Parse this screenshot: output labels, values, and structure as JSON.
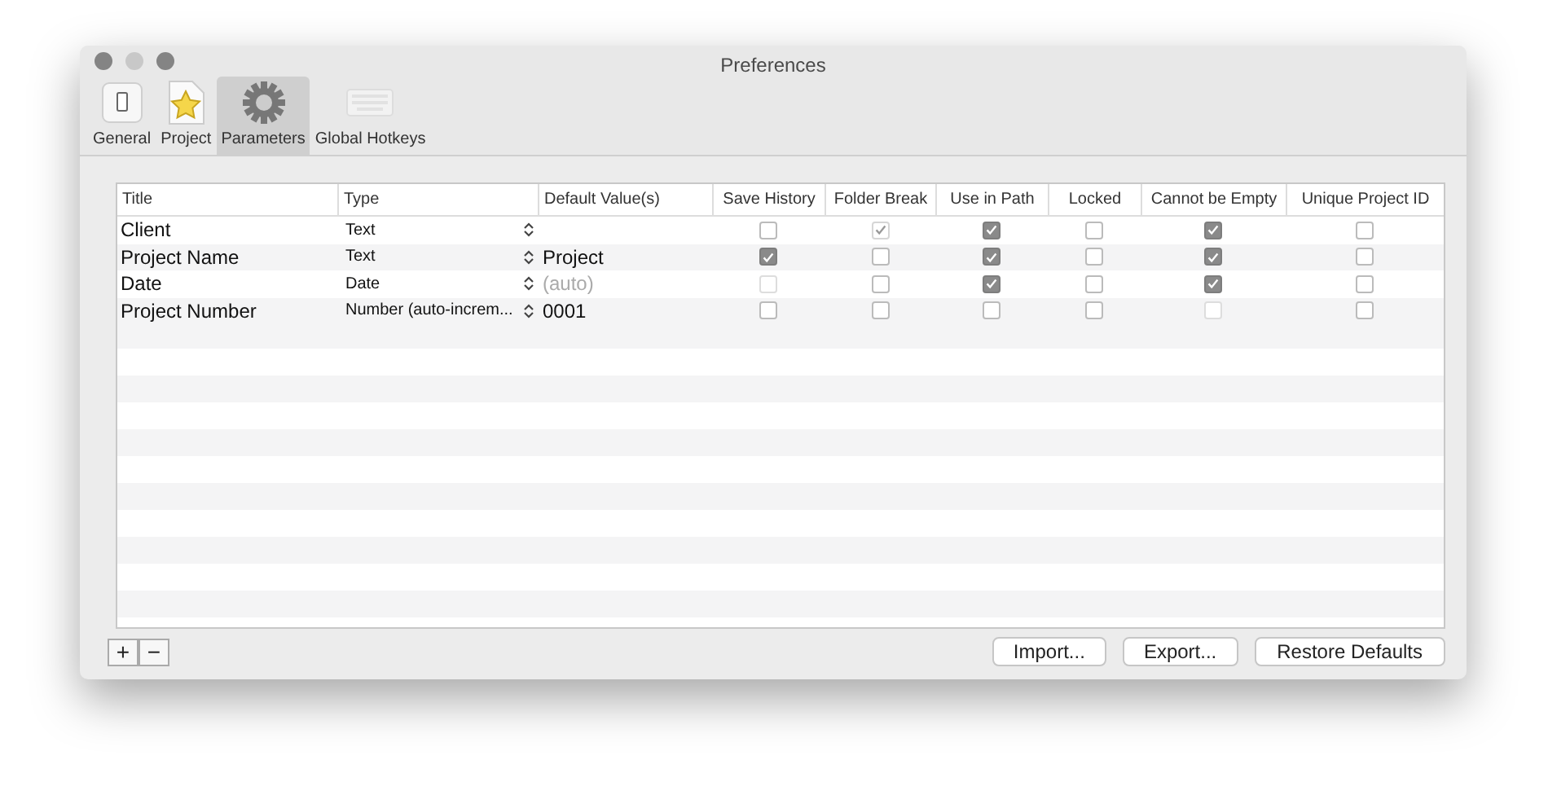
{
  "window": {
    "title": "Preferences"
  },
  "tabs": [
    {
      "label": "General",
      "selected": false
    },
    {
      "label": "Project",
      "selected": false
    },
    {
      "label": "Parameters",
      "selected": true
    },
    {
      "label": "Global Hotkeys",
      "selected": false
    }
  ],
  "table": {
    "columns": [
      "Title",
      "Type",
      "Default Value(s)",
      "Save History",
      "Folder Break",
      "Use in Path",
      "Locked",
      "Cannot be Empty",
      "Unique Project ID"
    ],
    "rows": [
      {
        "title": "Client",
        "type": "Text",
        "flags": [
          {
            "checked": false,
            "disabled": false
          },
          {
            "checked": true,
            "disabled": true
          },
          {
            "checked": true,
            "disabled": false
          },
          {
            "checked": false,
            "disabled": false
          },
          {
            "checked": true,
            "disabled": false
          },
          {
            "checked": false,
            "disabled": false
          }
        ]
      },
      {
        "title": "Project Name",
        "type": "Text",
        "value": "Project",
        "flags": [
          {
            "checked": true,
            "disabled": false
          },
          {
            "checked": false,
            "disabled": false
          },
          {
            "checked": true,
            "disabled": false
          },
          {
            "checked": false,
            "disabled": false
          },
          {
            "checked": true,
            "disabled": false
          },
          {
            "checked": false,
            "disabled": false
          }
        ]
      },
      {
        "title": "Date",
        "type": "Date",
        "placeholder": "(auto)",
        "flags": [
          {
            "checked": false,
            "disabled": true
          },
          {
            "checked": false,
            "disabled": false
          },
          {
            "checked": true,
            "disabled": false
          },
          {
            "checked": false,
            "disabled": false
          },
          {
            "checked": true,
            "disabled": false
          },
          {
            "checked": false,
            "disabled": false
          }
        ]
      },
      {
        "title": "Project Number",
        "type": "Number (auto-increm...",
        "value": "0001",
        "flags": [
          {
            "checked": false,
            "disabled": false
          },
          {
            "checked": false,
            "disabled": false
          },
          {
            "checked": false,
            "disabled": false
          },
          {
            "checked": false,
            "disabled": false
          },
          {
            "checked": false,
            "disabled": true
          },
          {
            "checked": false,
            "disabled": false
          }
        ]
      }
    ]
  },
  "add_remove": [
    "+",
    "−"
  ],
  "buttons": [
    "Import...",
    "Export...",
    "Restore Defaults"
  ]
}
